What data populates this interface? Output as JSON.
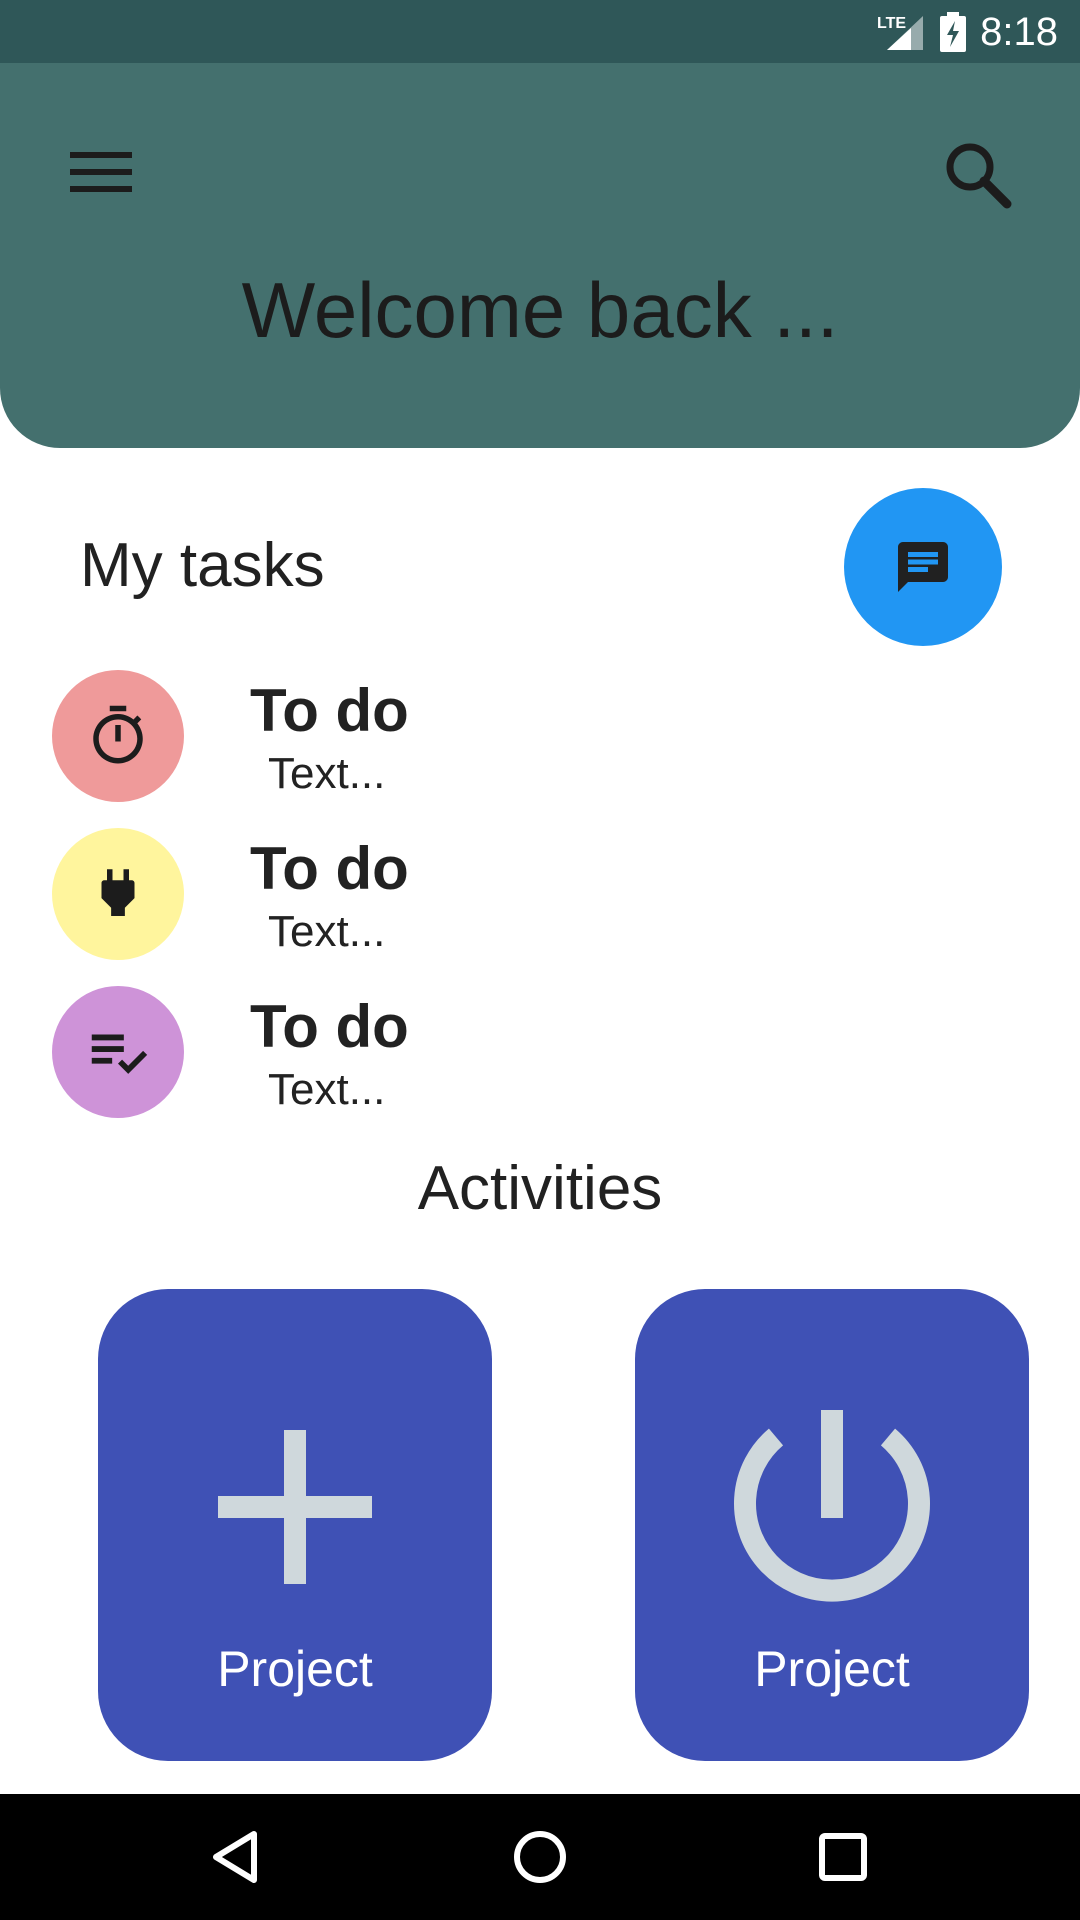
{
  "status_bar": {
    "network": "LTE",
    "time": "8:18",
    "icons": [
      "lte-signal-icon",
      "battery-charging-icon"
    ]
  },
  "header": {
    "welcome": "Welcome back ...",
    "icons": [
      "menu-icon",
      "search-icon"
    ]
  },
  "tasks_section": {
    "title": "My tasks",
    "fab_icon": "chat-icon",
    "items": [
      {
        "title": "To do",
        "subtitle": "Text...",
        "icon": "timer-icon",
        "color": "#ef9a9a"
      },
      {
        "title": "To do",
        "subtitle": "Text...",
        "icon": "power-plug-icon",
        "color": "#fff59d"
      },
      {
        "title": "To do",
        "subtitle": "Text...",
        "icon": "playlist-check-icon",
        "color": "#ce93d8"
      }
    ]
  },
  "activities": {
    "title": "Activities",
    "cards": [
      {
        "label": "Project",
        "icon": "plus-icon"
      },
      {
        "label": "Project",
        "icon": "power-icon"
      }
    ],
    "card_color": "#3f51b5",
    "icon_color": "#cfd8dc"
  },
  "nav_bar": {
    "buttons": [
      "back-icon",
      "home-icon",
      "recents-icon"
    ]
  },
  "colors": {
    "status_bar": "#2f5758",
    "header": "#44706e",
    "fab": "#2196f3"
  }
}
